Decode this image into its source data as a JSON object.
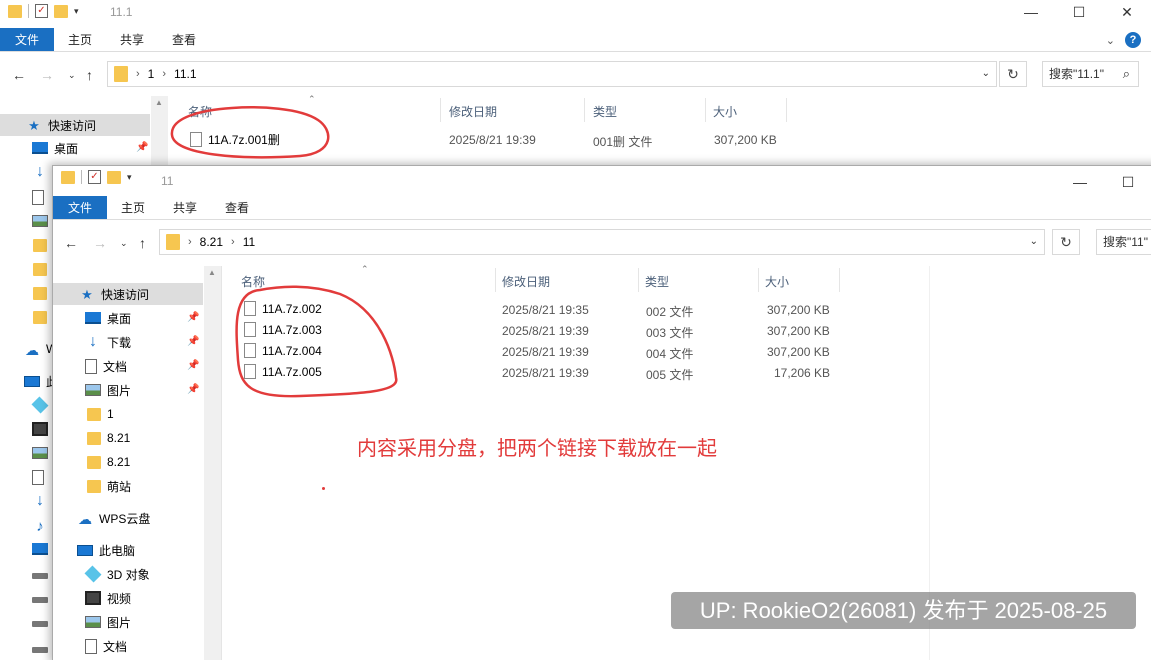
{
  "back_window": {
    "title": "11.1",
    "ribbon_tabs": [
      "文件",
      "主页",
      "共享",
      "查看"
    ],
    "address": [
      "1",
      "11.1"
    ],
    "search_placeholder": "搜索\"11.1\"",
    "sidebar": {
      "quick_access": "快速访问",
      "desktop": "桌面",
      "wps_cloud_partial": "W",
      "this_pc_partial": "此"
    },
    "columns": [
      "名称",
      "修改日期",
      "类型",
      "大小"
    ],
    "files": [
      {
        "name": "11A.7z.001删",
        "date": "2025/8/21 19:39",
        "type": "001删 文件",
        "size": "307,200 KB"
      }
    ]
  },
  "front_window": {
    "title": "11",
    "ribbon_tabs": [
      "文件",
      "主页",
      "共享",
      "查看"
    ],
    "address": [
      "8.21",
      "11"
    ],
    "search_placeholder": "搜索\"11\"",
    "sidebar": [
      {
        "label": "快速访问",
        "icon": "star-icon"
      },
      {
        "label": "桌面",
        "icon": "desktop-icon",
        "pinned": true
      },
      {
        "label": "下载",
        "icon": "download-icon",
        "pinned": true
      },
      {
        "label": "文档",
        "icon": "document-icon",
        "pinned": true
      },
      {
        "label": "图片",
        "icon": "picture-icon",
        "pinned": true
      },
      {
        "label": "1",
        "icon": "folder-icon"
      },
      {
        "label": "8.21",
        "icon": "folder-icon"
      },
      {
        "label": "8.21",
        "icon": "folder-icon"
      },
      {
        "label": "萌站",
        "icon": "folder-icon"
      },
      {
        "label": "WPS云盘",
        "icon": "cloud-icon"
      },
      {
        "label": "此电脑",
        "icon": "computer-icon"
      },
      {
        "label": "3D 对象",
        "icon": "3d-objects-icon"
      },
      {
        "label": "视频",
        "icon": "video-icon"
      },
      {
        "label": "图片",
        "icon": "picture-icon"
      },
      {
        "label": "文档",
        "icon": "document-icon"
      }
    ],
    "columns": [
      "名称",
      "修改日期",
      "类型",
      "大小"
    ],
    "files": [
      {
        "name": "11A.7z.002",
        "date": "2025/8/21 19:35",
        "type": "002 文件",
        "size": "307,200 KB"
      },
      {
        "name": "11A.7z.003",
        "date": "2025/8/21 19:39",
        "type": "003 文件",
        "size": "307,200 KB"
      },
      {
        "name": "11A.7z.004",
        "date": "2025/8/21 19:39",
        "type": "004 文件",
        "size": "307,200 KB"
      },
      {
        "name": "11A.7z.005",
        "date": "2025/8/21 19:39",
        "type": "005 文件",
        "size": "17,206 KB"
      }
    ]
  },
  "annotation": {
    "note": "内容采用分盘，把两个链接下载放在一起",
    "color": "#e23b3b"
  },
  "watermark": "UP: RookieO2(26081) 发布于 2025-08-25",
  "colors": {
    "accent": "#1a6fc2",
    "folder": "#f6c650"
  }
}
